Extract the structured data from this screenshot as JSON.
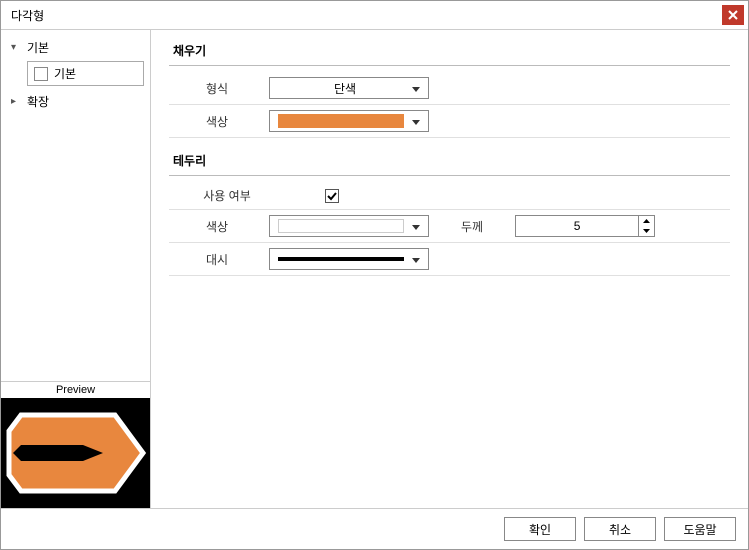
{
  "title": "다각형",
  "sidebar": {
    "items": [
      {
        "label": "기본",
        "expanded": true
      },
      {
        "label": "기본",
        "child": true
      },
      {
        "label": "확장",
        "expanded": false
      }
    ],
    "preview_label": "Preview"
  },
  "fill": {
    "section": "채우기",
    "type_label": "형식",
    "type_value": "단색",
    "color_label": "색상",
    "color_value": "#e8873e"
  },
  "border": {
    "section": "테두리",
    "use_label": "사용 여부",
    "use_checked": true,
    "color_label": "색상",
    "color_value": "#ffffff",
    "thickness_label": "두께",
    "thickness_value": "5",
    "dash_label": "대시"
  },
  "footer": {
    "ok": "확인",
    "cancel": "취소",
    "help": "도움말"
  },
  "preview_shape": {
    "fill": "#e8873e",
    "stroke": "#ffffff",
    "stroke_width": 5
  }
}
